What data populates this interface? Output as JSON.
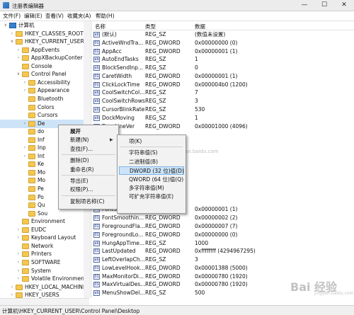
{
  "window": {
    "title": "注册表编辑器"
  },
  "menu": [
    "文件(F)",
    "编辑(E)",
    "查看(V)",
    "收藏夹(A)",
    "帮助(H)"
  ],
  "tree": [
    {
      "label": "计算机",
      "indent": 0,
      "exp": "∨",
      "icon": "pc"
    },
    {
      "label": "HKEY_CLASSES_ROOT",
      "indent": 1,
      "exp": "›",
      "icon": "folder"
    },
    {
      "label": "HKEY_CURRENT_USER",
      "indent": 1,
      "exp": "∨",
      "icon": "folder"
    },
    {
      "label": "AppEvents",
      "indent": 2,
      "exp": "›",
      "icon": "folder"
    },
    {
      "label": "AppXBackupConter",
      "indent": 2,
      "exp": "›",
      "icon": "folder"
    },
    {
      "label": "Console",
      "indent": 2,
      "exp": "",
      "icon": "folder"
    },
    {
      "label": "Control Panel",
      "indent": 2,
      "exp": "∨",
      "icon": "folder"
    },
    {
      "label": "Accessibility",
      "indent": 3,
      "exp": "›",
      "icon": "folder"
    },
    {
      "label": "Appearance",
      "indent": 3,
      "exp": "›",
      "icon": "folder"
    },
    {
      "label": "Bluetooth",
      "indent": 3,
      "exp": "",
      "icon": "folder"
    },
    {
      "label": "Colors",
      "indent": 3,
      "exp": "",
      "icon": "folder"
    },
    {
      "label": "Cursors",
      "indent": 3,
      "exp": "",
      "icon": "folder"
    },
    {
      "label": "De",
      "indent": 3,
      "exp": "›",
      "icon": "folder",
      "selected": true
    },
    {
      "label": "do",
      "indent": 3,
      "exp": "",
      "icon": "folder"
    },
    {
      "label": "Inf",
      "indent": 3,
      "exp": "",
      "icon": "folder"
    },
    {
      "label": "Inp",
      "indent": 3,
      "exp": "›",
      "icon": "folder"
    },
    {
      "label": "Int",
      "indent": 3,
      "exp": "›",
      "icon": "folder"
    },
    {
      "label": "Ke",
      "indent": 3,
      "exp": "",
      "icon": "folder"
    },
    {
      "label": "Mo",
      "indent": 3,
      "exp": "",
      "icon": "folder"
    },
    {
      "label": "Mo",
      "indent": 3,
      "exp": "",
      "icon": "folder"
    },
    {
      "label": "Pe",
      "indent": 3,
      "exp": "",
      "icon": "folder"
    },
    {
      "label": "Po",
      "indent": 3,
      "exp": "",
      "icon": "folder"
    },
    {
      "label": "Qu",
      "indent": 3,
      "exp": "",
      "icon": "folder"
    },
    {
      "label": "Sou",
      "indent": 3,
      "exp": "",
      "icon": "folder"
    },
    {
      "label": "Environment",
      "indent": 2,
      "exp": "",
      "icon": "folder"
    },
    {
      "label": "EUDC",
      "indent": 2,
      "exp": "›",
      "icon": "folder"
    },
    {
      "label": "Keyboard Layout",
      "indent": 2,
      "exp": "›",
      "icon": "folder"
    },
    {
      "label": "Network",
      "indent": 2,
      "exp": "",
      "icon": "folder"
    },
    {
      "label": "Printers",
      "indent": 2,
      "exp": "›",
      "icon": "folder"
    },
    {
      "label": "SOFTWARE",
      "indent": 2,
      "exp": "›",
      "icon": "folder"
    },
    {
      "label": "System",
      "indent": 2,
      "exp": "›",
      "icon": "folder"
    },
    {
      "label": "Volatile Environmen",
      "indent": 2,
      "exp": "›",
      "icon": "folder"
    },
    {
      "label": "HKEY_LOCAL_MACHINE",
      "indent": 1,
      "exp": "›",
      "icon": "folder"
    },
    {
      "label": "HKEY_USERS",
      "indent": 1,
      "exp": "›",
      "icon": "folder"
    },
    {
      "label": "HKEY_CURRENT_CONFIG",
      "indent": 1,
      "exp": "›",
      "icon": "folder"
    }
  ],
  "columns": {
    "name": "名称",
    "type": "类型",
    "data": "数据"
  },
  "values": [
    {
      "icon": "ab",
      "name": "(默认)",
      "type": "REG_SZ",
      "data": "(数值未设置)"
    },
    {
      "icon": "01",
      "name": "ActiveWndTra...",
      "type": "REG_DWORD",
      "data": "0x00000000 (0)"
    },
    {
      "icon": "01",
      "name": "AppAcc",
      "type": "REG_DWORD",
      "data": "0x00000001 (1)"
    },
    {
      "icon": "ab",
      "name": "AutoEndTasks",
      "type": "REG_SZ",
      "data": "1"
    },
    {
      "icon": "ab",
      "name": "BlockSendInp...",
      "type": "REG_SZ",
      "data": "0"
    },
    {
      "icon": "01",
      "name": "CaretWidth",
      "type": "REG_DWORD",
      "data": "0x00000001 (1)"
    },
    {
      "icon": "01",
      "name": "ClickLockTime",
      "type": "REG_DWORD",
      "data": "0x000004b0 (1200)"
    },
    {
      "icon": "ab",
      "name": "CoolSwitchCol...",
      "type": "REG_SZ",
      "data": "7"
    },
    {
      "icon": "ab",
      "name": "CoolSwitchRows",
      "type": "REG_SZ",
      "data": "3"
    },
    {
      "icon": "ab",
      "name": "CursorBlinkRate",
      "type": "REG_SZ",
      "data": "530"
    },
    {
      "icon": "ab",
      "name": "DockMoving",
      "type": "REG_SZ",
      "data": "1"
    },
    {
      "icon": "01",
      "name": "DragLineVer",
      "type": "REG_DWORD",
      "data": "0x00001000 (4096)"
    },
    {
      "icon": "",
      "name": "",
      "type": "",
      "data": ""
    },
    {
      "icon": "",
      "name": "",
      "type": "",
      "data": ""
    },
    {
      "icon": "",
      "name": "",
      "type": "",
      "data": ""
    },
    {
      "icon": "",
      "name": "",
      "type": "",
      "data": ""
    },
    {
      "icon": "",
      "name": "",
      "type": "",
      "data": ""
    },
    {
      "icon": "",
      "name": "",
      "type": "",
      "data": ""
    },
    {
      "icon": "",
      "name": "",
      "type": "",
      "data": ""
    },
    {
      "icon": "",
      "name": "",
      "type": "",
      "data": ""
    },
    {
      "icon": "",
      "name": "",
      "type": "",
      "data": ""
    },
    {
      "icon": "01",
      "name": "FontSmoothin...",
      "type": "REG_DWORD",
      "data": "0x00000001 (1)"
    },
    {
      "icon": "01",
      "name": "FontSmoothin...",
      "type": "REG_DWORD",
      "data": "0x00000002 (2)"
    },
    {
      "icon": "01",
      "name": "ForegroundFla...",
      "type": "REG_DWORD",
      "data": "0x00000007 (7)"
    },
    {
      "icon": "01",
      "name": "ForegroundLo...",
      "type": "REG_DWORD",
      "data": "0x00000000 (0)"
    },
    {
      "icon": "ab",
      "name": "HungAppTime...",
      "type": "REG_SZ",
      "data": "1000"
    },
    {
      "icon": "01",
      "name": "LastUpdated",
      "type": "REG_DWORD",
      "data": "0xffffffff (4294967295)"
    },
    {
      "icon": "ab",
      "name": "LeftOverlapCh...",
      "type": "REG_SZ",
      "data": "3"
    },
    {
      "icon": "01",
      "name": "LowLevelHook...",
      "type": "REG_DWORD",
      "data": "0x00001388 (5000)"
    },
    {
      "icon": "01",
      "name": "MaxMonitorDi...",
      "type": "REG_DWORD",
      "data": "0x00000780 (1920)"
    },
    {
      "icon": "01",
      "name": "MaxVirtualDes...",
      "type": "REG_DWORD",
      "data": "0x00000780 (1920)"
    },
    {
      "icon": "ab",
      "name": "MenuShowDel...",
      "type": "REG_SZ",
      "data": "500"
    }
  ],
  "context_menu": {
    "items": [
      {
        "label": "展开",
        "bold": true
      },
      {
        "label": "新建(N)",
        "submenu": true
      },
      {
        "label": "查找(F)..."
      },
      {
        "sep": true
      },
      {
        "label": "删除(D)"
      },
      {
        "label": "重命名(R)"
      },
      {
        "sep": true
      },
      {
        "label": "导出(E)"
      },
      {
        "label": "权限(P)..."
      },
      {
        "sep": true
      },
      {
        "label": "复制项名称(C)"
      }
    ]
  },
  "submenu": {
    "items": [
      {
        "label": "项(K)"
      },
      {
        "sep": true
      },
      {
        "label": "字符串值(S)"
      },
      {
        "label": "二进制值(B)"
      },
      {
        "label": "DWORD (32 位)值(D)",
        "highlight": true
      },
      {
        "label": "QWORD (64 位)值(Q)"
      },
      {
        "label": "多字符串值(M)"
      },
      {
        "label": "可扩充字符串值(E)"
      }
    ]
  },
  "ghost_text": "jingyan.baidu.com",
  "status": "计算机\\HKEY_CURRENT_USER\\Control Panel\\Desktop",
  "watermark": {
    "logo": "Bai 经验",
    "sub": "jingyan.baidu.com"
  }
}
